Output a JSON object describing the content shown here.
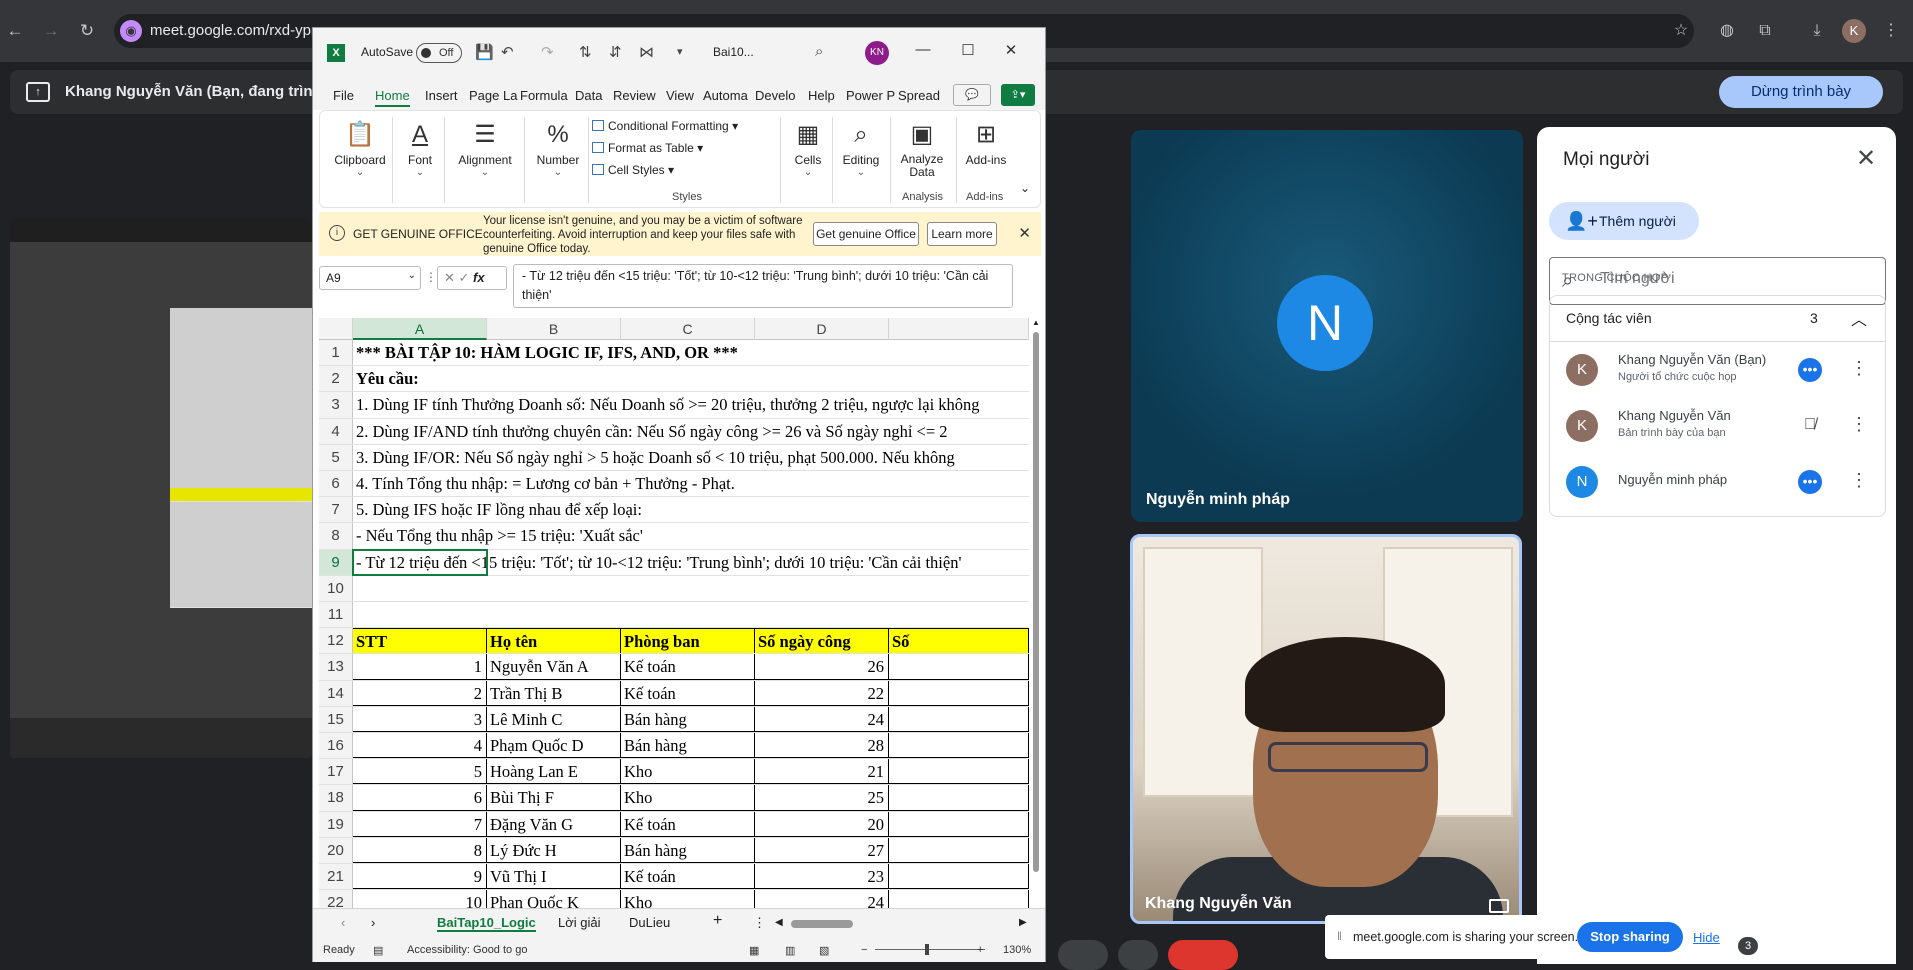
{
  "browser": {
    "url": "meet.google.com/rxd-ypm",
    "back_icon": "←",
    "forward_icon": "→",
    "reload_icon": "↻",
    "profile_initial": "K"
  },
  "meet": {
    "presenting_title": "Khang Nguyễn Văn (Bạn, đang trình bày)",
    "stop_presenting": "Dừng trình bày",
    "tile1_name": "Nguyễn minh pháp",
    "tile1_initial": "N",
    "tile2_name": "Khang Nguyễn Văn",
    "share_message": "meet.google.com is sharing your screen.",
    "stop_sharing": "Stop sharing",
    "hide": "Hide",
    "badge_count": "3"
  },
  "people": {
    "title": "Mọi người",
    "add_label": "Thêm người",
    "search_placeholder": "Tìm người",
    "section": "TRONG CUỘC HỌP",
    "group_label": "Cộng tác viên",
    "group_count": "3",
    "members": [
      {
        "initial": "K",
        "name": "Khang Nguyễn Văn (Bạn)",
        "sub": "Người tổ chức cuộc họp",
        "color": "#8d6e63"
      },
      {
        "initial": "K",
        "name": "Khang Nguyễn Văn",
        "sub": "Bản trình bày của bạn",
        "color": "#8d6e63"
      },
      {
        "initial": "N",
        "name": "Nguyễn minh pháp",
        "sub": "",
        "color": "#1e88e5"
      }
    ]
  },
  "excel": {
    "autosave": "AutoSave",
    "toggle": "Off",
    "doc_name": "Bai10...",
    "user_initials": "KN",
    "tabs": [
      "File",
      "Home",
      "Insert",
      "Page La",
      "Formula",
      "Data",
      "Review",
      "View",
      "Automa",
      "Develo",
      "Help",
      "Power P",
      "Spread"
    ],
    "ribbon": {
      "clipboard": "Clipboard",
      "font": "Font",
      "alignment": "Alignment",
      "number": "Number",
      "conditional": "Conditional Formatting",
      "format_table": "Format as Table",
      "cell_styles": "Cell Styles",
      "styles_group": "Styles",
      "cells": "Cells",
      "editing": "Editing",
      "analyze": "Analyze Data",
      "analysis_group": "Analysis",
      "addins": "Add-ins",
      "addins_group": "Add-ins"
    },
    "infobar": {
      "title": "GET GENUINE OFFICE",
      "text": "Your license isn't genuine, and you may be a victim of software counterfeiting. Avoid interruption and keep your files safe with genuine Office today.",
      "btn1": "Get genuine Office",
      "btn2": "Learn more"
    },
    "name_box": "A9",
    "formula": "- Từ 12 triệu đến <15 triệu: 'Tốt'; từ 10-<12 triệu: 'Trung bình'; dưới 10 triệu: 'Cần cải thiện'",
    "columns": [
      "A",
      "B",
      "C",
      "D"
    ],
    "rows": [
      {
        "n": "1",
        "a": "*** BÀI TẬP 10: HÀM LOGIC IF, IFS, AND, OR ***",
        "bold": true
      },
      {
        "n": "2",
        "a": "Yêu cầu:",
        "bold": true
      },
      {
        "n": "3",
        "a": "1. Dùng IF tính Thưởng Doanh số: Nếu Doanh số >= 20 triệu, thưởng 2 triệu, ngược lại không"
      },
      {
        "n": "4",
        "a": "2. Dùng IF/AND tính thưởng chuyên cần: Nếu Số ngày công >= 26 và Số ngày nghỉ <= 2"
      },
      {
        "n": "5",
        "a": "3. Dùng IF/OR: Nếu Số ngày nghỉ > 5 hoặc Doanh số < 10 triệu, phạt 500.000. Nếu không"
      },
      {
        "n": "6",
        "a": "4. Tính Tổng thu nhập: = Lương cơ bản + Thưởng - Phạt."
      },
      {
        "n": "7",
        "a": "5. Dùng IFS hoặc IF lồng nhau để xếp loại:"
      },
      {
        "n": "8",
        "a": "   - Nếu Tổng thu nhập >= 15 triệu: 'Xuất sắc'"
      },
      {
        "n": "9",
        "a": "   - Từ 12 triệu đến <15 triệu: 'Tốt'; từ 10-<12 triệu: 'Trung bình'; dưới 10 triệu: 'Cần cải thiện'"
      },
      {
        "n": "10",
        "a": ""
      },
      {
        "n": "11",
        "a": ""
      }
    ],
    "table_header": {
      "n": "12",
      "stt": "STT",
      "name": "Họ tên",
      "dept": "Phòng ban",
      "days": "Số ngày công",
      "e": "Số"
    },
    "table_rows": [
      {
        "n": "13",
        "stt": "1",
        "name": "Nguyễn Văn A",
        "dept": "Kế toán",
        "days": "26"
      },
      {
        "n": "14",
        "stt": "2",
        "name": "Trần Thị B",
        "dept": "Kế toán",
        "days": "22"
      },
      {
        "n": "15",
        "stt": "3",
        "name": "Lê Minh C",
        "dept": "Bán hàng",
        "days": "24"
      },
      {
        "n": "16",
        "stt": "4",
        "name": "Phạm Quốc D",
        "dept": "Bán hàng",
        "days": "28"
      },
      {
        "n": "17",
        "stt": "5",
        "name": "Hoàng Lan E",
        "dept": "Kho",
        "days": "21"
      },
      {
        "n": "18",
        "stt": "6",
        "name": "Bùi Thị F",
        "dept": "Kho",
        "days": "25"
      },
      {
        "n": "19",
        "stt": "7",
        "name": "Đặng Văn G",
        "dept": "Kế toán",
        "days": "20"
      },
      {
        "n": "20",
        "stt": "8",
        "name": "Lý Đức H",
        "dept": "Bán hàng",
        "days": "27"
      },
      {
        "n": "21",
        "stt": "9",
        "name": "Vũ Thị I",
        "dept": "Kế toán",
        "days": "23"
      },
      {
        "n": "22",
        "stt": "10",
        "name": "Phan Quốc K",
        "dept": "Kho",
        "days": "24"
      }
    ],
    "sheets": [
      "BaiTap10_Logic",
      "Lời giải",
      "DuLieu"
    ],
    "status_ready": "Ready",
    "accessibility": "Accessibility: Good to go",
    "zoom": "130%"
  }
}
